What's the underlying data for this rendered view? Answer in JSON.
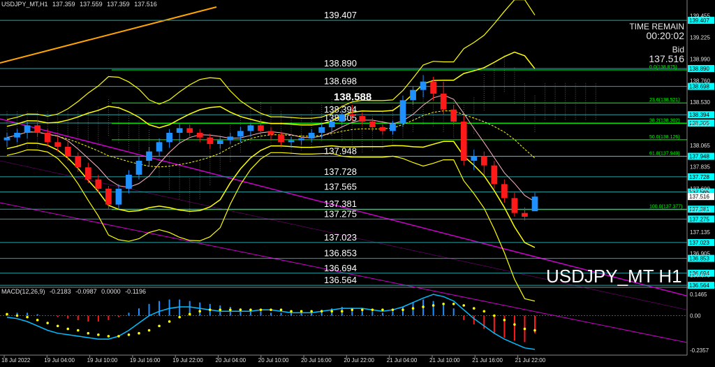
{
  "header": {
    "symbol": "USDJPY_MT,H1",
    "open": "137.359",
    "high": "137.559",
    "low": "137.359",
    "close": "137.516"
  },
  "info_panel": {
    "time_remain_label": "TIME REMAIN",
    "time_remain_value": "00:20:02",
    "bid_label": "Bid",
    "bid_value": "137.516"
  },
  "watermark": "USDJPY_MT H1",
  "floating_label": "138.588",
  "colors": {
    "background": "#000000",
    "grid": "#333333",
    "bull": "#1e90ff",
    "bear": "#ff1a1a",
    "level_line": "#2aa5a5",
    "level_label": "#00ffff",
    "bollinger": "#ffff00",
    "ma_pink": "#ffb6c1",
    "fib": "#00ff00",
    "channel": "#cc00cc",
    "trend_orange": "#ffa500",
    "macd_signal": "#ffff00",
    "macd_main": "#00bfff"
  },
  "price_axis": {
    "labels": [
      "139.455",
      "139.225",
      "138.990",
      "138.760",
      "138.530",
      "138.295",
      "138.065",
      "137.835",
      "137.600",
      "137.370",
      "137.135",
      "136.905",
      "136.675"
    ]
  },
  "levels": [
    {
      "price": 139.407,
      "label": "139.407"
    },
    {
      "price": 138.89,
      "label": "138.890"
    },
    {
      "price": 138.698,
      "label": "138.698"
    },
    {
      "price": 138.394,
      "label": "138.394"
    },
    {
      "price": 138.305,
      "label": "138.305"
    },
    {
      "price": 137.948,
      "label": "137.948"
    },
    {
      "price": 137.728,
      "label": "137.728"
    },
    {
      "price": 137.565,
      "label": "137.565"
    },
    {
      "price": 137.381,
      "label": "137.381"
    },
    {
      "price": 137.275,
      "label": "137.275"
    },
    {
      "price": 137.023,
      "label": "137.023"
    },
    {
      "price": 136.853,
      "label": "136.853"
    },
    {
      "price": 136.694,
      "label": "136.694"
    },
    {
      "price": 136.564,
      "label": "136.564"
    }
  ],
  "fib_levels": [
    {
      "price": 138.875,
      "label": "0.0(138.875)"
    },
    {
      "price": 138.521,
      "label": "23.6(138.521)"
    },
    {
      "price": 138.302,
      "label": "38.2(138.302)"
    },
    {
      "price": 138.126,
      "label": "50.0(138.126)"
    },
    {
      "price": 137.949,
      "label": "61.8(137.949)"
    },
    {
      "price": 137.377,
      "label": "100.0(137.377)"
    }
  ],
  "current_price": "137.516",
  "time_axis": [
    "18 Jul 2022",
    "19 Jul 04:00",
    "19 Jul 10:00",
    "19 Jul 16:00",
    "19 Jul 22:00",
    "20 Jul 04:00",
    "20 Jul 10:00",
    "20 Jul 16:00",
    "20 Jul 22:00",
    "21 Jul 04:00",
    "21 Jul 10:00",
    "21 Jul 16:00",
    "21 Jul 22:00"
  ],
  "macd": {
    "label": "MACD(12,26,9)",
    "main": "-0.2183",
    "signal": "-0.0987",
    "hist": "0.0000",
    "extra": "-0.1196",
    "axis_labels": [
      "0.1465",
      "0.00",
      "-0.2357"
    ]
  },
  "chart_data": {
    "type": "candlestick",
    "symbol": "USDJPY_MT",
    "timeframe": "H1",
    "y_range": [
      136.55,
      139.55
    ],
    "candles": [
      {
        "o": 138.12,
        "h": 138.2,
        "l": 138.05,
        "c": 138.15
      },
      {
        "o": 138.15,
        "h": 138.24,
        "l": 138.1,
        "c": 138.2
      },
      {
        "o": 138.2,
        "h": 138.32,
        "l": 138.14,
        "c": 138.28
      },
      {
        "o": 138.28,
        "h": 138.34,
        "l": 138.16,
        "c": 138.2
      },
      {
        "o": 138.2,
        "h": 138.24,
        "l": 138.06,
        "c": 138.1
      },
      {
        "o": 138.1,
        "h": 138.16,
        "l": 138.0,
        "c": 138.05
      },
      {
        "o": 138.05,
        "h": 138.12,
        "l": 137.9,
        "c": 137.95
      },
      {
        "o": 137.95,
        "h": 137.99,
        "l": 137.78,
        "c": 137.83
      },
      {
        "o": 137.83,
        "h": 137.88,
        "l": 137.66,
        "c": 137.7
      },
      {
        "o": 137.7,
        "h": 137.75,
        "l": 137.56,
        "c": 137.6
      },
      {
        "o": 137.6,
        "h": 137.63,
        "l": 137.38,
        "c": 137.43
      },
      {
        "o": 137.43,
        "h": 137.65,
        "l": 137.38,
        "c": 137.6
      },
      {
        "o": 137.6,
        "h": 137.8,
        "l": 137.55,
        "c": 137.75
      },
      {
        "o": 137.75,
        "h": 137.94,
        "l": 137.7,
        "c": 137.9
      },
      {
        "o": 137.9,
        "h": 138.05,
        "l": 137.85,
        "c": 138.0
      },
      {
        "o": 138.0,
        "h": 138.14,
        "l": 137.95,
        "c": 138.1
      },
      {
        "o": 138.1,
        "h": 138.24,
        "l": 138.04,
        "c": 138.2
      },
      {
        "o": 138.2,
        "h": 138.3,
        "l": 138.1,
        "c": 138.25
      },
      {
        "o": 138.25,
        "h": 138.29,
        "l": 138.16,
        "c": 138.2
      },
      {
        "o": 138.2,
        "h": 138.24,
        "l": 138.1,
        "c": 138.15
      },
      {
        "o": 138.15,
        "h": 138.19,
        "l": 138.03,
        "c": 138.08
      },
      {
        "o": 138.08,
        "h": 138.15,
        "l": 138.03,
        "c": 138.12
      },
      {
        "o": 138.12,
        "h": 138.2,
        "l": 138.08,
        "c": 138.16
      },
      {
        "o": 138.16,
        "h": 138.26,
        "l": 138.1,
        "c": 138.22
      },
      {
        "o": 138.22,
        "h": 138.31,
        "l": 138.16,
        "c": 138.28
      },
      {
        "o": 138.28,
        "h": 138.34,
        "l": 138.18,
        "c": 138.22
      },
      {
        "o": 138.22,
        "h": 138.26,
        "l": 138.12,
        "c": 138.18
      },
      {
        "o": 138.18,
        "h": 138.21,
        "l": 138.06,
        "c": 138.1
      },
      {
        "o": 138.1,
        "h": 138.16,
        "l": 138.04,
        "c": 138.12
      },
      {
        "o": 138.12,
        "h": 138.18,
        "l": 138.07,
        "c": 138.14
      },
      {
        "o": 138.14,
        "h": 138.24,
        "l": 138.1,
        "c": 138.2
      },
      {
        "o": 138.2,
        "h": 138.3,
        "l": 138.14,
        "c": 138.26
      },
      {
        "o": 138.26,
        "h": 138.36,
        "l": 138.2,
        "c": 138.32
      },
      {
        "o": 138.32,
        "h": 138.45,
        "l": 138.28,
        "c": 138.4
      },
      {
        "o": 138.4,
        "h": 138.5,
        "l": 138.33,
        "c": 138.38
      },
      {
        "o": 138.38,
        "h": 138.42,
        "l": 138.28,
        "c": 138.32
      },
      {
        "o": 138.32,
        "h": 138.36,
        "l": 138.22,
        "c": 138.26
      },
      {
        "o": 138.26,
        "h": 138.3,
        "l": 138.18,
        "c": 138.22
      },
      {
        "o": 138.22,
        "h": 138.33,
        "l": 138.18,
        "c": 138.3
      },
      {
        "o": 138.3,
        "h": 138.6,
        "l": 138.26,
        "c": 138.55
      },
      {
        "o": 138.55,
        "h": 138.7,
        "l": 138.5,
        "c": 138.66
      },
      {
        "o": 138.66,
        "h": 138.82,
        "l": 138.58,
        "c": 138.75
      },
      {
        "o": 138.75,
        "h": 138.8,
        "l": 138.55,
        "c": 138.62
      },
      {
        "o": 138.62,
        "h": 138.75,
        "l": 138.4,
        "c": 138.45
      },
      {
        "o": 138.45,
        "h": 138.5,
        "l": 138.28,
        "c": 138.32
      },
      {
        "o": 138.32,
        "h": 138.38,
        "l": 137.85,
        "c": 137.9
      },
      {
        "o": 137.9,
        "h": 138.02,
        "l": 137.8,
        "c": 137.95
      },
      {
        "o": 137.95,
        "h": 138.0,
        "l": 137.75,
        "c": 137.85
      },
      {
        "o": 137.85,
        "h": 137.9,
        "l": 137.6,
        "c": 137.65
      },
      {
        "o": 137.65,
        "h": 137.7,
        "l": 137.45,
        "c": 137.5
      },
      {
        "o": 137.5,
        "h": 137.56,
        "l": 137.3,
        "c": 137.34
      },
      {
        "o": 137.34,
        "h": 137.4,
        "l": 137.26,
        "c": 137.3
      },
      {
        "o": 137.359,
        "h": 137.559,
        "l": 137.359,
        "c": 137.516
      }
    ],
    "macd_histogram": [
      0.01,
      0.02,
      0.02,
      0.01,
      0.0,
      -0.01,
      -0.02,
      -0.03,
      -0.04,
      -0.04,
      -0.03,
      -0.01,
      0.02,
      0.05,
      0.08,
      0.1,
      0.11,
      0.11,
      0.1,
      0.09,
      0.08,
      0.07,
      0.06,
      0.05,
      0.04,
      0.03,
      0.02,
      0.02,
      0.03,
      0.03,
      0.03,
      0.04,
      0.05,
      0.06,
      0.05,
      0.04,
      0.03,
      0.02,
      0.03,
      0.06,
      0.09,
      0.11,
      0.1,
      0.08,
      0.05,
      -0.03,
      -0.06,
      -0.09,
      -0.12,
      -0.15,
      -0.17,
      -0.18,
      -0.12
    ],
    "macd_main": [
      -0.01,
      -0.02,
      -0.04,
      -0.07,
      -0.1,
      -0.12,
      -0.13,
      -0.14,
      -0.15,
      -0.16,
      -0.16,
      -0.14,
      -0.1,
      -0.05,
      0.0,
      0.03,
      0.05,
      0.06,
      0.06,
      0.05,
      0.04,
      0.03,
      0.03,
      0.03,
      0.03,
      0.04,
      0.04,
      0.03,
      0.02,
      0.02,
      0.02,
      0.03,
      0.04,
      0.05,
      0.05,
      0.05,
      0.04,
      0.03,
      0.04,
      0.06,
      0.09,
      0.12,
      0.145,
      0.13,
      0.1,
      0.04,
      -0.02,
      -0.07,
      -0.12,
      -0.16,
      -0.19,
      -0.22,
      -0.23
    ],
    "macd_signal": [
      0.01,
      0.0,
      -0.01,
      -0.03,
      -0.05,
      -0.07,
      -0.09,
      -0.1,
      -0.12,
      -0.13,
      -0.14,
      -0.14,
      -0.13,
      -0.12,
      -0.1,
      -0.07,
      -0.04,
      -0.01,
      0.01,
      0.03,
      0.04,
      0.04,
      0.04,
      0.04,
      0.04,
      0.04,
      0.04,
      0.04,
      0.03,
      0.03,
      0.03,
      0.03,
      0.03,
      0.03,
      0.04,
      0.04,
      0.04,
      0.04,
      0.04,
      0.04,
      0.05,
      0.06,
      0.07,
      0.08,
      0.08,
      0.07,
      0.05,
      0.03,
      0.0,
      -0.03,
      -0.06,
      -0.09,
      -0.1
    ],
    "macd_range": [
      -0.25,
      0.16
    ]
  }
}
